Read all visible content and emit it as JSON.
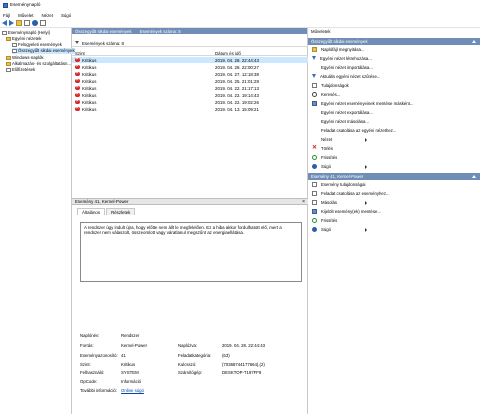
{
  "window": {
    "title": "Eseménynapló"
  },
  "menu": [
    "Fájl",
    "Művelet",
    "Nézet",
    "Súgó"
  ],
  "tree": {
    "items": [
      {
        "label": "Eseménynapló (Helyi)",
        "indent": 0,
        "icon": "computer-icon"
      },
      {
        "label": "Egyéni nézetek",
        "indent": 1,
        "icon": "folder-icon"
      },
      {
        "label": "Felügyeleti események",
        "indent": 2,
        "icon": "log-icon"
      },
      {
        "label": "Összegyűlt sikdai események",
        "indent": 2,
        "icon": "log-icon"
      },
      {
        "label": "Windows-naplók",
        "indent": 1,
        "icon": "folder-icon"
      },
      {
        "label": "Alkalmazás- és szolgáltatásn...",
        "indent": 1,
        "icon": "folder-icon"
      },
      {
        "label": "Előfizetések",
        "indent": 1,
        "icon": "log-icon"
      }
    ]
  },
  "center": {
    "header_title": "Összegyűlt sikdai események",
    "header_count": "Események száma: 8",
    "filter_text": "Események száma: 8",
    "columns": {
      "level": "Szint",
      "datetime": "Dátum és idő"
    },
    "events": [
      {
        "level": "Kritikus",
        "datetime": "2019. 04. 28. 22:44:43"
      },
      {
        "level": "Kritikus",
        "datetime": "2019. 04. 28. 22:00:27"
      },
      {
        "level": "Kritikus",
        "datetime": "2019. 04. 27. 12:18:38"
      },
      {
        "level": "Kritikus",
        "datetime": "2019. 04. 25. 21:01:28"
      },
      {
        "level": "Kritikus",
        "datetime": "2019. 04. 22. 21:17:13"
      },
      {
        "level": "Kritikus",
        "datetime": "2019. 04. 22. 19:14:43"
      },
      {
        "level": "Kritikus",
        "datetime": "2019. 04. 22. 19:02:26"
      },
      {
        "level": "Kritikus",
        "datetime": "2019. 04. 13. 15:09:21"
      }
    ],
    "detail_title": "Esemény 41, Kernel-Power",
    "tabs": [
      "Általános",
      "Részletek"
    ],
    "message": "A rendszer úgy indult újra, hogy előtte nem állt le megfelelően. Ez a hiba akkor fordulhatott elő, mert a rendszer nem válaszolt, összeomlott vagy váratlanul megszűnt az energiaellátása.",
    "props": {
      "log_name_label": "Naplónév:",
      "log_name": "Rendszer",
      "source_label": "Forrás:",
      "source": "Kernel-Power",
      "logged_label": "Naplózva:",
      "logged": "2019. 04. 28. 22:44:43",
      "event_id_label": "Eseményazonosító:",
      "event_id": "41",
      "task_label": "Feladatkategória:",
      "task": "(63)",
      "level_label": "Szint:",
      "level": "Kritikus",
      "keywords_label": "Kulcsszó:",
      "keywords": "(70368744177664),(2)",
      "user_label": "Felhasználó:",
      "user": "SYSTEM",
      "computer_label": "Számítógép:",
      "computer": "DESKTOP-T197FF9",
      "opcode_label": "OpCode:",
      "opcode": "Információ",
      "more_label": "További információ:",
      "more_link": "Online súgó"
    }
  },
  "actions": {
    "title": "Műveletek",
    "section1": "Összegyűlt sikdai események",
    "items1": [
      {
        "label": "Naplófájl megnyitása...",
        "icon": "folder-open-icon"
      },
      {
        "label": "Egyéni nézet létrehozása...",
        "icon": "filter-icon"
      },
      {
        "label": "Egyéni nézet importálása...",
        "icon": "blank"
      },
      {
        "label": "Aktuális egyéni nézet szűrése...",
        "icon": "filter-icon"
      },
      {
        "label": "Tulajdonságok",
        "icon": "properties-icon"
      },
      {
        "label": "Keresés...",
        "icon": "search-icon"
      },
      {
        "label": "Egyéni nézet eseményeinek mentése másként...",
        "icon": "save-icon"
      },
      {
        "label": "Egyéni nézet exportálása...",
        "icon": "blank"
      },
      {
        "label": "Egyéni nézet másolása...",
        "icon": "blank"
      },
      {
        "label": "Feladat csatolása az egyéni nézethez...",
        "icon": "blank"
      },
      {
        "label": "Nézet",
        "icon": "blank",
        "submenu": true
      },
      {
        "label": "Törlés",
        "icon": "delete-icon"
      },
      {
        "label": "Frissítés",
        "icon": "refresh-icon"
      },
      {
        "label": "Súgó",
        "icon": "help-icon",
        "submenu": true
      }
    ],
    "section2": "Esemény 41, Kernel-Power",
    "items2": [
      {
        "label": "Esemény tulajdonságai",
        "icon": "properties-icon"
      },
      {
        "label": "Feladat csatolása az eseményhez...",
        "icon": "task-icon"
      },
      {
        "label": "Másolás",
        "icon": "copy-icon",
        "submenu": true
      },
      {
        "label": "Kijelölt esemény(ek) mentése...",
        "icon": "save-icon"
      },
      {
        "label": "Frissítés",
        "icon": "refresh-icon"
      },
      {
        "label": "Súgó",
        "icon": "help-icon",
        "submenu": true
      }
    ]
  }
}
